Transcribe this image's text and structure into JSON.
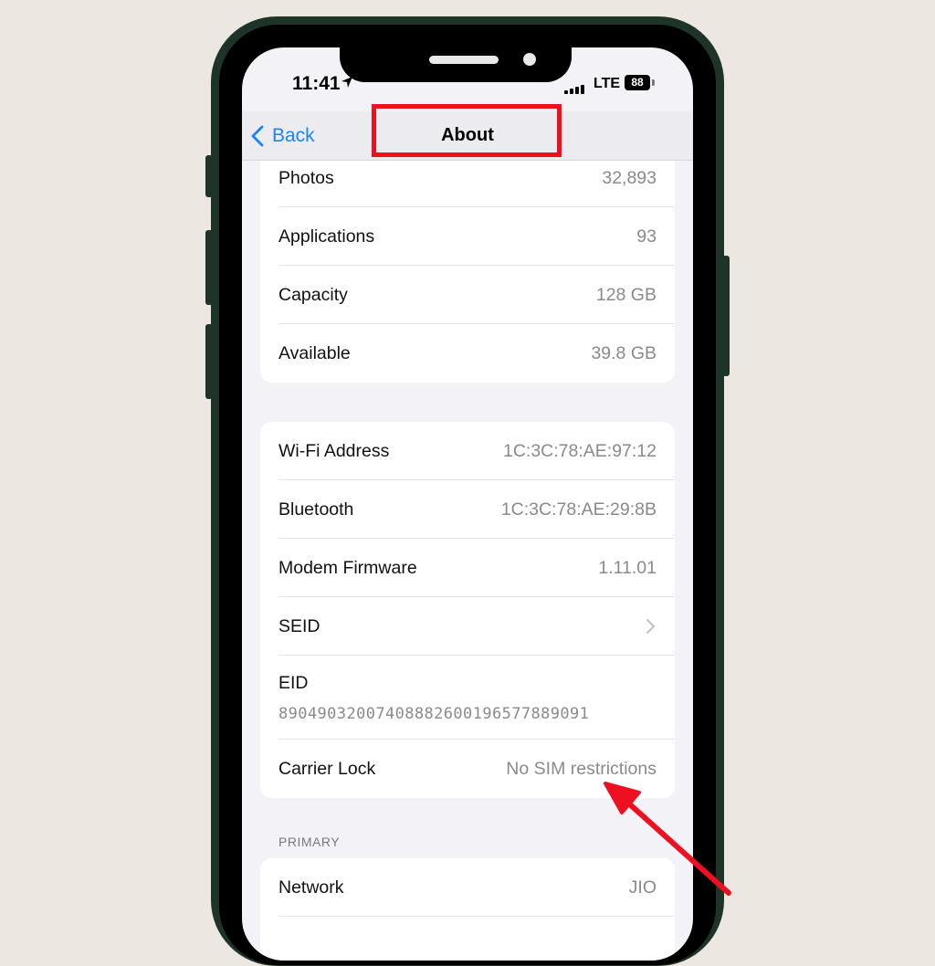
{
  "status_bar": {
    "time": "11:41",
    "network": "LTE",
    "battery": "88"
  },
  "nav": {
    "back_label": "Back",
    "title": "About"
  },
  "storage_rows": [
    {
      "label": "Photos",
      "value": "32,893"
    },
    {
      "label": "Applications",
      "value": "93"
    },
    {
      "label": "Capacity",
      "value": "128 GB"
    },
    {
      "label": "Available",
      "value": "39.8 GB"
    }
  ],
  "network_rows": {
    "wifi": {
      "label": "Wi-Fi Address",
      "value": "1C:3C:78:AE:97:12"
    },
    "bluetooth": {
      "label": "Bluetooth",
      "value": "1C:3C:78:AE:29:8B"
    },
    "modem": {
      "label": "Modem Firmware",
      "value": "1.11.01"
    },
    "seid": {
      "label": "SEID"
    },
    "eid": {
      "label": "EID",
      "value": "89049032007408882600196577889091"
    },
    "carrier_lock": {
      "label": "Carrier Lock",
      "value": "No SIM restrictions"
    }
  },
  "primary": {
    "section_label": "PRIMARY",
    "network": {
      "label": "Network",
      "value": "JIO"
    }
  },
  "colors": {
    "accent": "#1a84f5",
    "annotation": "#ee1020",
    "phone_frame": "#1f3429"
  }
}
